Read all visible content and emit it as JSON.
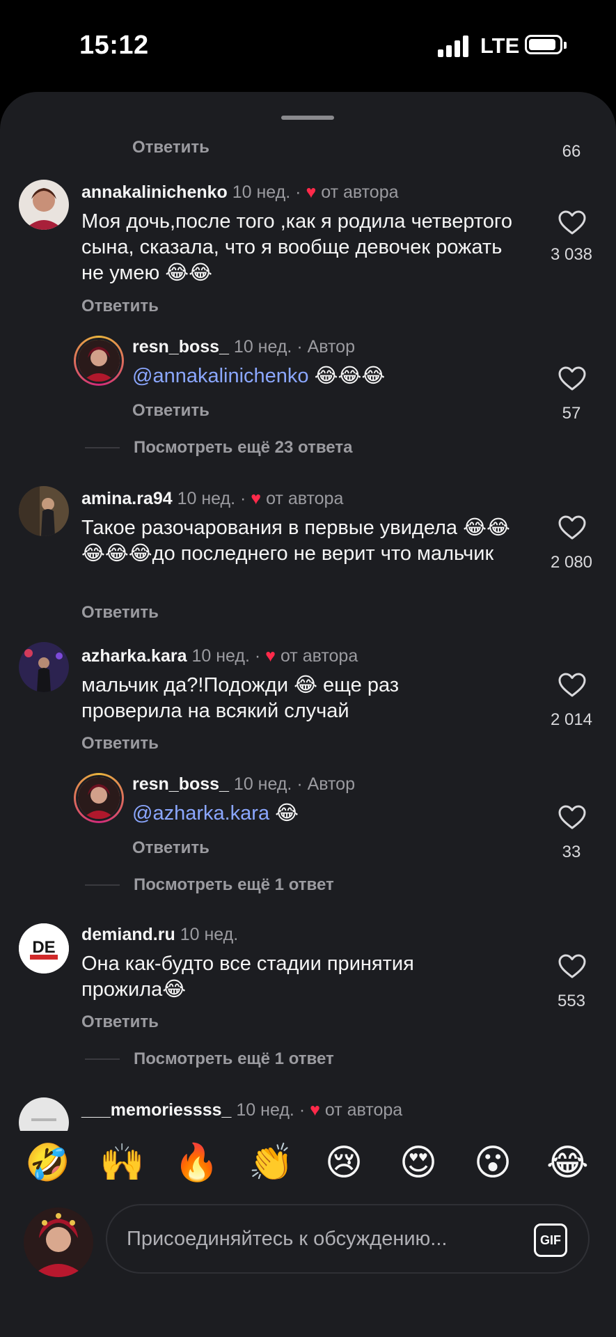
{
  "status_bar": {
    "time": "15:12",
    "network": "LTE"
  },
  "reply_label": "Ответить",
  "top_remnant": {
    "like_count": "66"
  },
  "comments": [
    {
      "username": "annakalinichenko",
      "time": "10 нед.",
      "separator": "·",
      "liked_by_author": "от автора",
      "text": "Моя дочь,после того ,как я родила четвертого сына, сказала, что я вообще девочек рожать не умею 😂😂",
      "like_count": "3 038"
    },
    {
      "username": "resn_boss_",
      "time": "10 нед.",
      "separator": "·",
      "author_badge": "Автор",
      "mention": "@annakalinichenko",
      "text": " 😂😂😂",
      "like_count": "57"
    },
    {
      "username": "amina.ra94",
      "time": "10 нед.",
      "separator": "·",
      "liked_by_author": "от автора",
      "text": "Такое разочарования в первые увидела 😂😂😂😂😂до последнего не верит что мальчик",
      "like_count": "2 080"
    },
    {
      "username": "azharka.kara",
      "time": "10 нед.",
      "separator": "·",
      "liked_by_author": "от автора",
      "text": "мальчик да?!Подожди 😂 еще раз проверила на всякий случай",
      "like_count": "2 014"
    },
    {
      "username": "resn_boss_",
      "time": "10 нед.",
      "separator": "·",
      "author_badge": "Автор",
      "mention": "@azharka.kara",
      "text": " 😂",
      "like_count": "33"
    },
    {
      "username": "demiand.ru",
      "time": "10 нед.",
      "text": "Она как-будто все стадии принятия прожила😂",
      "like_count": "553"
    },
    {
      "username": "___memoriessss_",
      "time": "10 нед.",
      "separator": "·",
      "liked_by_author": "от автора"
    }
  ],
  "more_replies": [
    "Посмотреть ещё 23 ответа",
    "Посмотреть ещё 1 ответ",
    "Посмотреть ещё 1 ответ"
  ],
  "emoji_bar": [
    "🤣",
    "🙌",
    "🔥",
    "👏",
    "😢",
    "😍",
    "😮",
    "😂"
  ],
  "input": {
    "placeholder": "Присоединяйтесь к обсуждению...",
    "gif_label": "GIF"
  },
  "colors": {
    "background": "#000000",
    "sheet": "#1c1d21",
    "mention": "#8ba7ff",
    "heart": "#ff2a4a",
    "secondary_text": "#9b9ba0"
  }
}
